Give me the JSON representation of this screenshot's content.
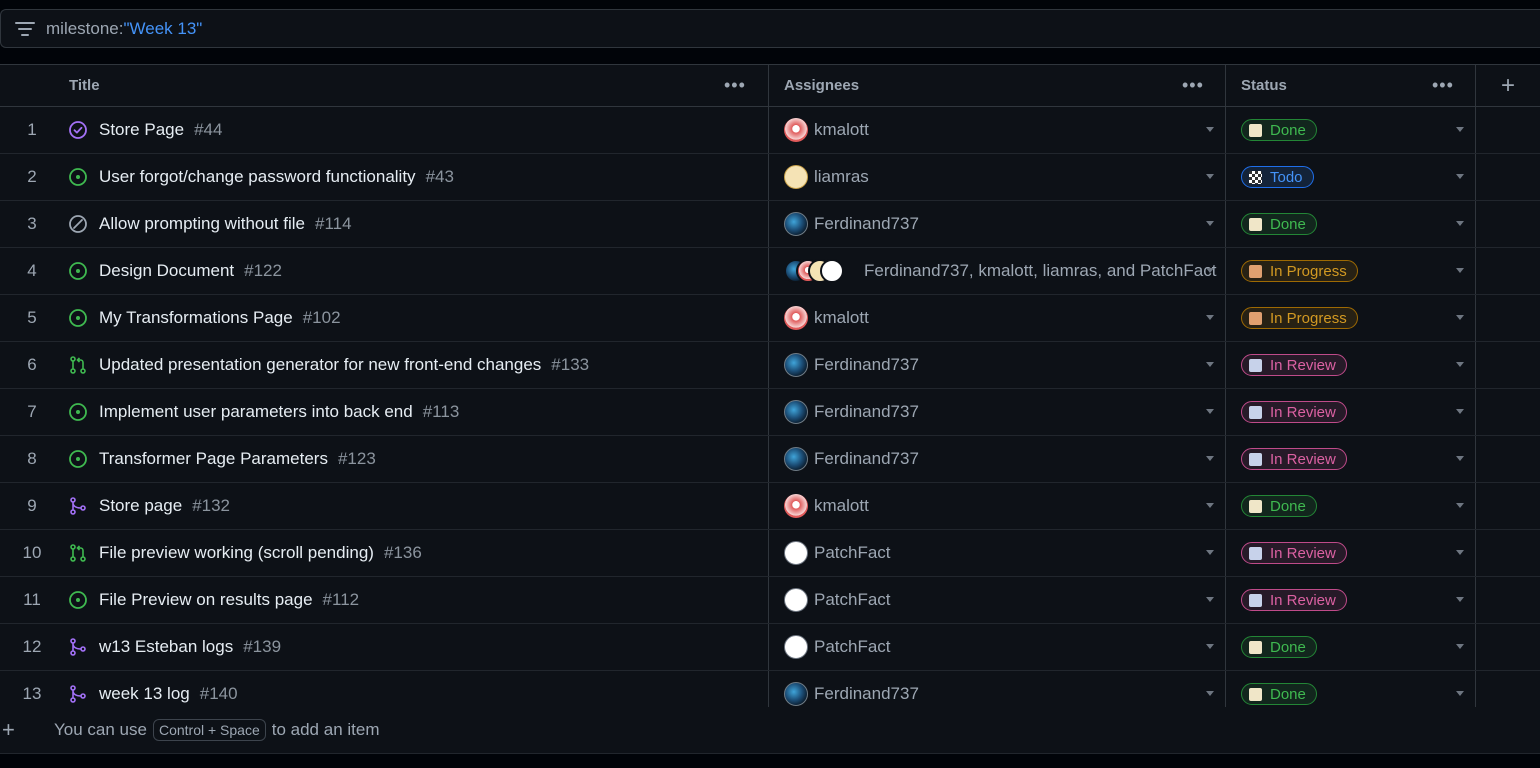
{
  "filter": {
    "prefix": "milestone:",
    "value": "\"Week 13\""
  },
  "columns": {
    "title": "Title",
    "assignees": "Assignees",
    "status": "Status",
    "more_glyph": "•••",
    "add_glyph": "+"
  },
  "colors": {
    "done": "#3fb950",
    "todo": "#4493f8",
    "in_progress": "#d29922",
    "in_review": "#db61a2",
    "open_issue": "#3fb950",
    "closed_issue": "#a371f7",
    "not_planned": "#9da7b3"
  },
  "rows": [
    {
      "n": "1",
      "icon": "closed-issue-icon",
      "title": "Store Page",
      "num": "#44",
      "assignees": "kmalott",
      "avatar": "k",
      "status": "Done",
      "status_type": "done"
    },
    {
      "n": "2",
      "icon": "open-issue-icon",
      "title": "User forgot/change password functionality",
      "num": "#43",
      "assignees": "liamras",
      "avatar": "l",
      "status": "Todo",
      "status_type": "todo"
    },
    {
      "n": "3",
      "icon": "not-planned-icon",
      "title": "Allow prompting without file",
      "num": "#114",
      "assignees": "Ferdinand737",
      "avatar": "f",
      "status": "Done",
      "status_type": "done"
    },
    {
      "n": "4",
      "icon": "open-issue-icon",
      "title": "Design Document",
      "num": "#122",
      "assignees": "Ferdinand737, kmalott, liamras, and PatchFact",
      "avatar": "multi",
      "status": "In Progress",
      "status_type": "prog"
    },
    {
      "n": "5",
      "icon": "open-issue-icon",
      "title": "My Transformations Page",
      "num": "#102",
      "assignees": "kmalott",
      "avatar": "k",
      "status": "In Progress",
      "status_type": "prog"
    },
    {
      "n": "6",
      "icon": "open-pr-icon",
      "title": "Updated presentation generator for new front-end changes",
      "num": "#133",
      "assignees": "Ferdinand737",
      "avatar": "f",
      "status": "In Review",
      "status_type": "rev"
    },
    {
      "n": "7",
      "icon": "open-issue-icon",
      "title": "Implement user parameters into back end",
      "num": "#113",
      "assignees": "Ferdinand737",
      "avatar": "f",
      "status": "In Review",
      "status_type": "rev"
    },
    {
      "n": "8",
      "icon": "open-issue-icon",
      "title": "Transformer Page Parameters",
      "num": "#123",
      "assignees": "Ferdinand737",
      "avatar": "f",
      "status": "In Review",
      "status_type": "rev"
    },
    {
      "n": "9",
      "icon": "merged-pr-icon",
      "title": "Store page",
      "num": "#132",
      "assignees": "kmalott",
      "avatar": "k",
      "status": "Done",
      "status_type": "done"
    },
    {
      "n": "10",
      "icon": "open-pr-icon",
      "title": "File preview working (scroll pending)",
      "num": "#136",
      "assignees": "PatchFact",
      "avatar": "p",
      "status": "In Review",
      "status_type": "rev"
    },
    {
      "n": "11",
      "icon": "open-issue-icon",
      "title": "File Preview on results page",
      "num": "#112",
      "assignees": "PatchFact",
      "avatar": "p",
      "status": "In Review",
      "status_type": "rev"
    },
    {
      "n": "12",
      "icon": "merged-pr-icon",
      "title": "w13 Esteban logs",
      "num": "#139",
      "assignees": "PatchFact",
      "avatar": "p",
      "status": "Done",
      "status_type": "done"
    },
    {
      "n": "13",
      "icon": "merged-pr-icon",
      "title": "week 13 log",
      "num": "#140",
      "assignees": "Ferdinand737",
      "avatar": "f",
      "status": "Done",
      "status_type": "done"
    }
  ],
  "footer": {
    "pre": "You can use",
    "kbd": "Control + Space",
    "post": "to add an item",
    "plus": "+"
  }
}
